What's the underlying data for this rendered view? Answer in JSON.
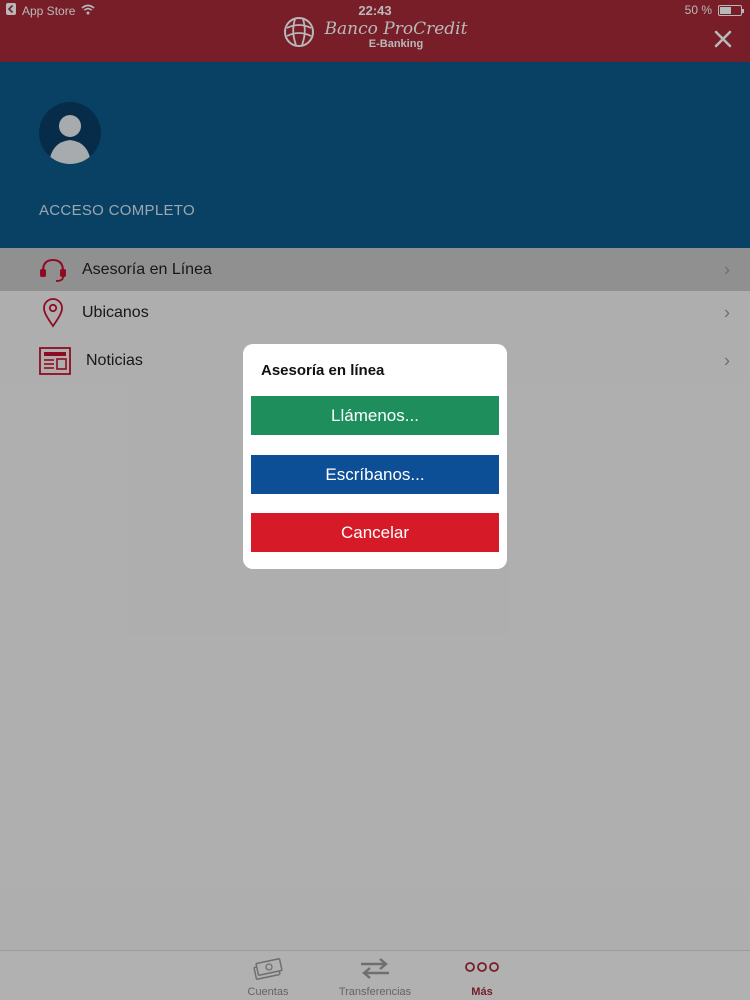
{
  "status_bar": {
    "back_app": "App Store",
    "time": "22:43",
    "battery": "50 %",
    "battery_level": 0.5
  },
  "header": {
    "brand_name": "Banco ProCredit",
    "brand_sub": "E-Banking",
    "close_icon": "close-icon",
    "color": "#a52a3a"
  },
  "profile": {
    "access_label": "ACCESO COMPLETO",
    "color": "#0d5a8c"
  },
  "menu": {
    "items": [
      {
        "label": "Asesoría en Línea",
        "icon": "headset-icon",
        "active": true
      },
      {
        "label": "Ubicanos",
        "icon": "location-pin-icon",
        "active": false
      },
      {
        "label": "Noticias",
        "icon": "newspaper-icon",
        "active": false
      }
    ]
  },
  "tabbar": {
    "tabs": [
      {
        "label": "Cuentas",
        "icon": "money-stack-icon",
        "active": false
      },
      {
        "label": "Transferencias",
        "icon": "transfer-arrows-icon",
        "active": false
      },
      {
        "label": "Más",
        "icon": "more-dots-icon",
        "active": true
      }
    ]
  },
  "dialog": {
    "title": "Asesoría en línea",
    "buttons": [
      {
        "label": "Llámenos...",
        "color": "#1e8f5c"
      },
      {
        "label": "Escríbanos...",
        "color": "#0d4f97"
      },
      {
        "label": "Cancelar",
        "color": "#d71a28"
      }
    ]
  }
}
